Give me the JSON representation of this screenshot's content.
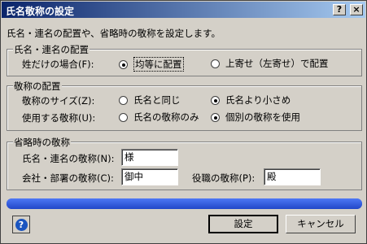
{
  "window": {
    "title": "氏名敬称の設定",
    "help_glyph": "?",
    "close_glyph": "×"
  },
  "intro": "氏名・連名の配置や、省略時の敬称を設定します。",
  "placement": {
    "legend": "氏名・連名の配置",
    "row_label": "姓だけの場合(F):",
    "options": [
      "均等に配置",
      "上寄せ（左寄せ）で配置"
    ],
    "selected": "均等に配置"
  },
  "honorific_placement": {
    "legend": "敬称の配置",
    "size_label": "敬称のサイズ(Z):",
    "size_options": [
      "氏名と同じ",
      "氏名より小さめ"
    ],
    "size_selected": "氏名より小さめ",
    "use_label": "使用する敬称(U):",
    "use_options": [
      "氏名の敬称のみ",
      "個別の敬称を使用"
    ],
    "use_selected": "個別の敬称を使用"
  },
  "default_honorific": {
    "legend": "省略時の敬称",
    "name_label": "氏名・連名の敬称(N):",
    "name_value": "様",
    "company_label": "会社・部署の敬称(C):",
    "company_value": "御中",
    "position_label": "役職の敬称(P):",
    "position_value": "殿"
  },
  "progress": {
    "fraction": 1.0,
    "color": "#2a52d6"
  },
  "buttons": {
    "help_glyph": "?",
    "ok": "設定",
    "cancel": "キャンセル"
  },
  "icons": [
    "help-icon",
    "close-icon"
  ]
}
